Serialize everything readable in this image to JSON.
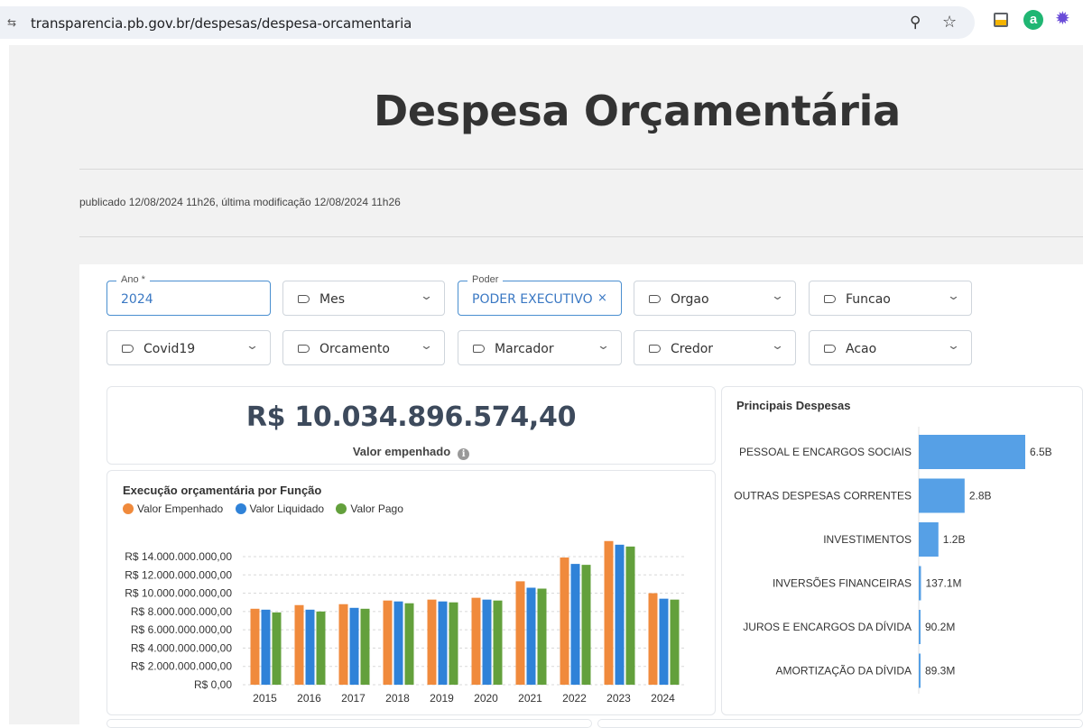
{
  "browser": {
    "url": "transparencia.pb.gov.br/despesas/despesa-orcamentaria",
    "icons": [
      "site-settings-icon",
      "zoom-icon",
      "bookmark-star-icon",
      "extension-icon",
      "amazon-assistant-icon",
      "extension-flower-icon"
    ]
  },
  "page": {
    "title": "Despesa Orçamentária",
    "published": "publicado 12/08/2024 11h26, última modificação 12/08/2024 11h26"
  },
  "filters": {
    "ano": {
      "label": "Ano *",
      "value": "2024"
    },
    "mes": {
      "label": "Mes"
    },
    "poder": {
      "label": "Poder",
      "value": "PODER EXECUTIVO",
      "clear": "×"
    },
    "orgao": {
      "label": "Orgao"
    },
    "funcao": {
      "label": "Funcao"
    },
    "covid19": {
      "label": "Covid19"
    },
    "orcamento": {
      "label": "Orcamento"
    },
    "marcador": {
      "label": "Marcador"
    },
    "credor": {
      "label": "Credor"
    },
    "acao": {
      "label": "Acao"
    }
  },
  "kpi": {
    "value": "R$ 10.034.896.574,40",
    "label": "Valor empenhado",
    "info_icon": "i"
  },
  "colors": {
    "empenhado": "#f08a3c",
    "liquidado": "#2f82d8",
    "pago": "#63a03c",
    "hbar": "#56a0e6"
  },
  "chart_data": [
    {
      "type": "bar",
      "title": "Execução orçamentária por Função",
      "categories": [
        "2015",
        "2016",
        "2017",
        "2018",
        "2019",
        "2020",
        "2021",
        "2022",
        "2023",
        "2024"
      ],
      "series": [
        {
          "name": "Valor Empenhado",
          "values": [
            8300000000,
            8700000000,
            8800000000,
            9200000000,
            9300000000,
            9500000000,
            11300000000,
            13900000000,
            15700000000,
            10000000000
          ]
        },
        {
          "name": "Valor Liquidado",
          "values": [
            8200000000,
            8200000000,
            8400000000,
            9100000000,
            9100000000,
            9300000000,
            10600000000,
            13200000000,
            15300000000,
            9400000000
          ]
        },
        {
          "name": "Valor Pago",
          "values": [
            7900000000,
            8000000000,
            8300000000,
            8900000000,
            9000000000,
            9200000000,
            10500000000,
            13100000000,
            15100000000,
            9300000000
          ]
        }
      ],
      "ylim": [
        0,
        14000000000
      ],
      "yticks": [
        "R$ 0,00",
        "R$ 2.000.000.000,00",
        "R$ 4.000.000.000,00",
        "R$ 6.000.000.000,00",
        "R$ 8.000.000.000,00",
        "R$ 10.000.000.000,00",
        "R$ 12.000.000.000,00",
        "R$ 14.000.000.000,00"
      ],
      "grid": true,
      "legend": "top-left"
    },
    {
      "type": "bar",
      "orientation": "horizontal",
      "title": "Principais Despesas",
      "categories": [
        "PESSOAL E ENCARGOS SOCIAIS",
        "OUTRAS DESPESAS CORRENTES",
        "INVESTIMENTOS",
        "INVERSÕES FINANCEIRAS",
        "JUROS E ENCARGOS DA DÍVIDA",
        "AMORTIZAÇÃO DA DÍVIDA"
      ],
      "values": [
        6500000000,
        2800000000,
        1200000000,
        137100000,
        90200000,
        89300000
      ],
      "labels": [
        "6.5B",
        "2.8B",
        "1.2B",
        "137.1M",
        "90.2M",
        "89.3M"
      ]
    }
  ]
}
